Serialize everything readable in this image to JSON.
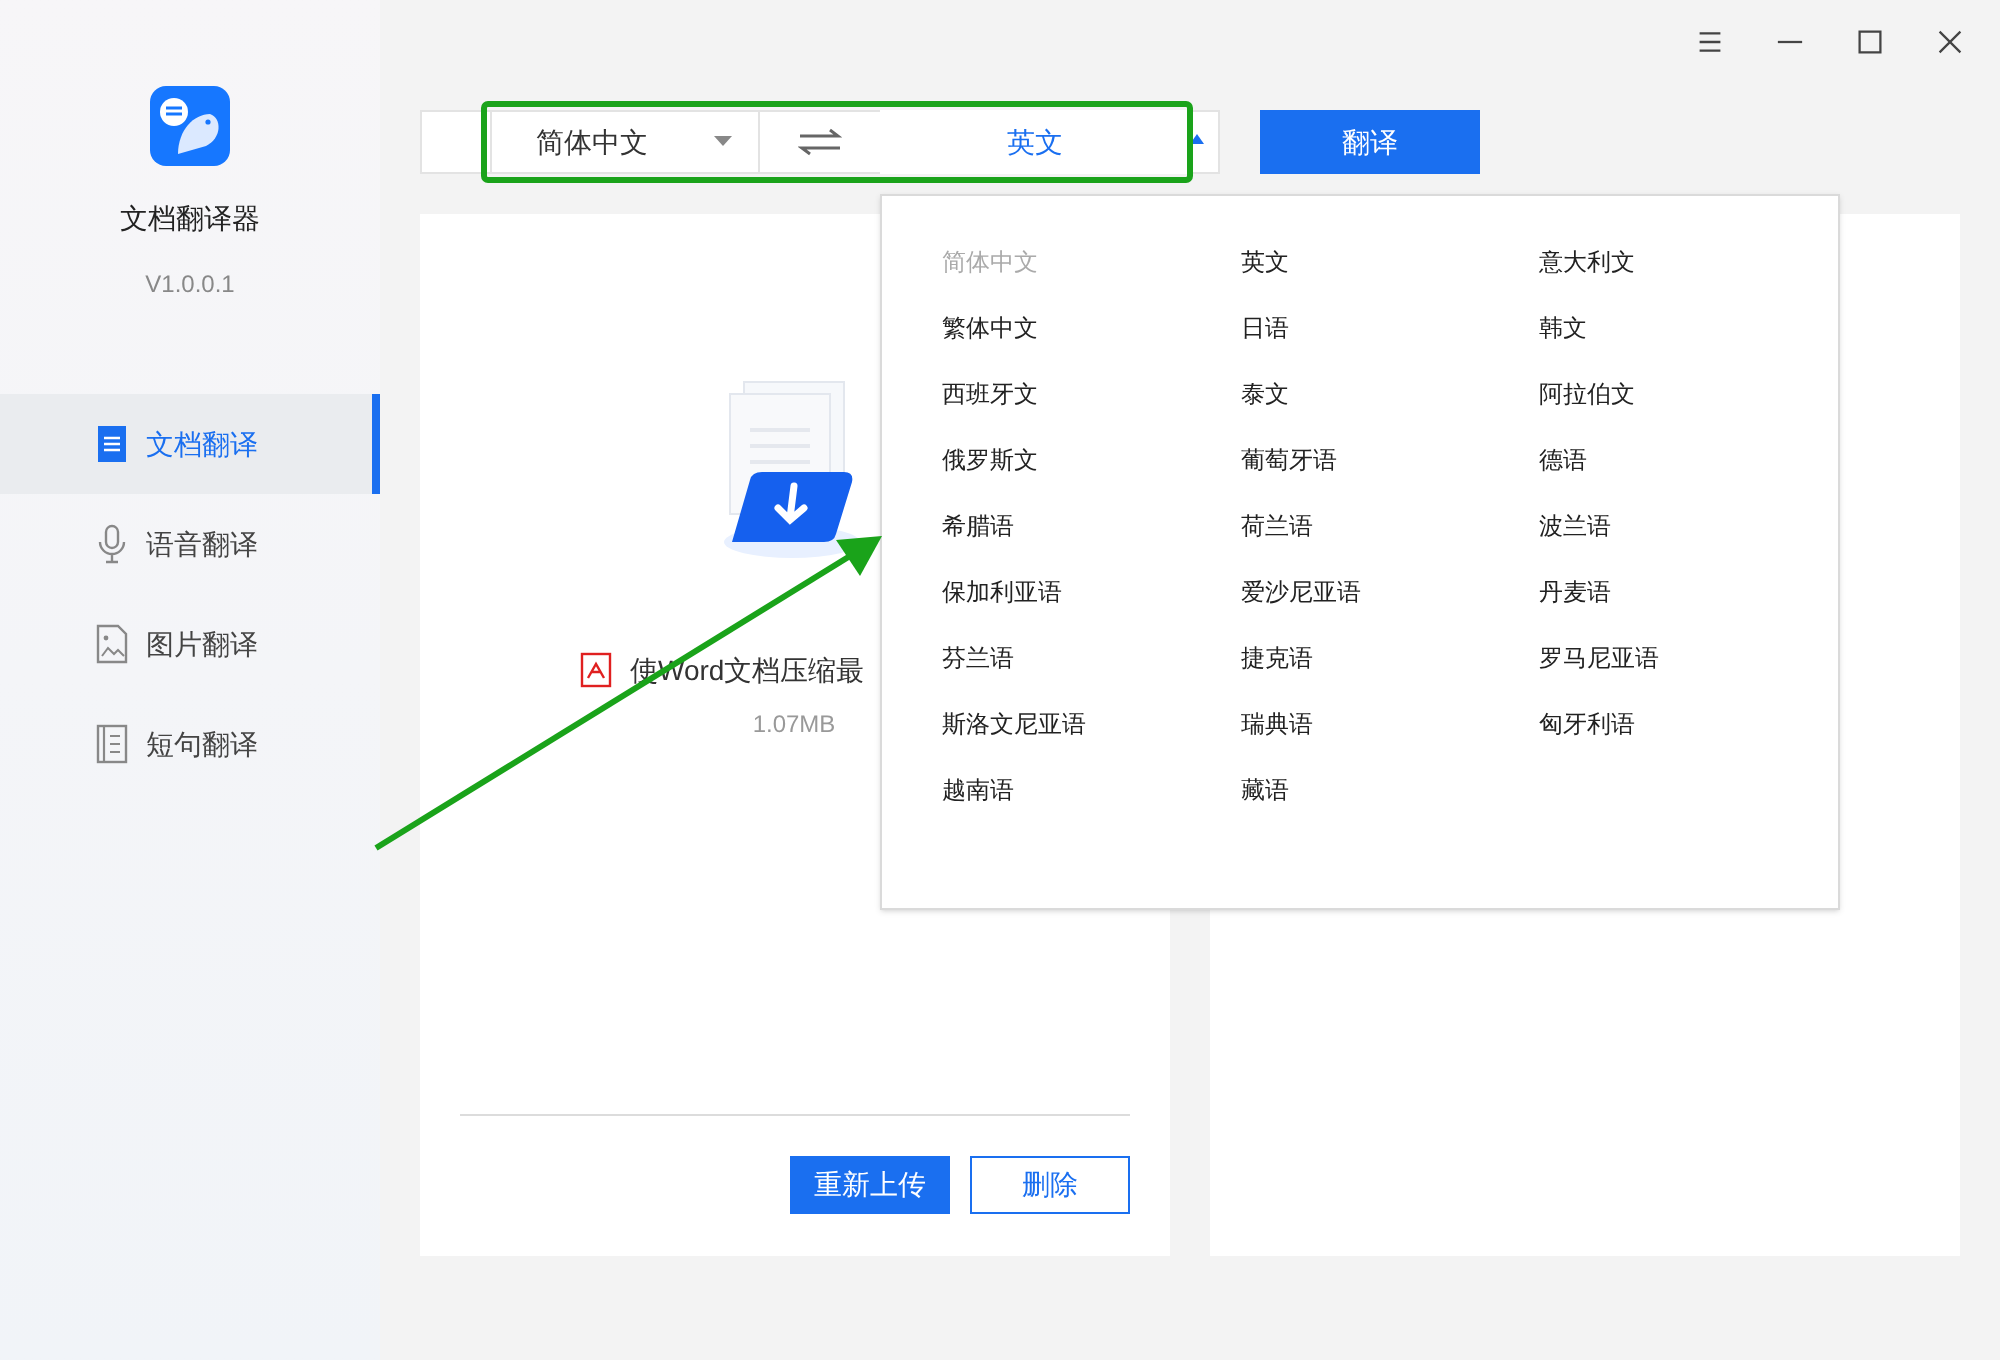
{
  "app": {
    "name": "文档翻译器",
    "version": "V1.0.0.1"
  },
  "window_controls": [
    {
      "kind": "menu"
    },
    {
      "kind": "minimize"
    },
    {
      "kind": "maximize"
    },
    {
      "kind": "close"
    }
  ],
  "sidebar": {
    "items": [
      {
        "label": "文档翻译",
        "kind": "document",
        "selected": true
      },
      {
        "label": "语音翻译",
        "kind": "voice",
        "selected": false
      },
      {
        "label": "图片翻译",
        "kind": "image",
        "selected": false
      },
      {
        "label": "短句翻译",
        "kind": "sentence",
        "selected": false
      }
    ]
  },
  "toolbar": {
    "source_language": "简体中文",
    "target_language": "英文",
    "target_open": true,
    "translate_button": "翻译"
  },
  "file_card": {
    "file_name": "使Word文档压缩最",
    "file_size": "1.07MB",
    "buttons": [
      {
        "label": "重新上传",
        "kind": "primary"
      },
      {
        "label": "删除",
        "kind": "outline"
      }
    ]
  },
  "language_menu": {
    "items": [
      {
        "label": "简体中文",
        "disabled": true
      },
      {
        "label": "英文",
        "disabled": false
      },
      {
        "label": "意大利文",
        "disabled": false
      },
      {
        "label": "繁体中文",
        "disabled": false
      },
      {
        "label": "日语",
        "disabled": false
      },
      {
        "label": "韩文",
        "disabled": false
      },
      {
        "label": "西班牙文",
        "disabled": false
      },
      {
        "label": "泰文",
        "disabled": false
      },
      {
        "label": "阿拉伯文",
        "disabled": false
      },
      {
        "label": "俄罗斯文",
        "disabled": false
      },
      {
        "label": "葡萄牙语",
        "disabled": false
      },
      {
        "label": "德语",
        "disabled": false
      },
      {
        "label": "希腊语",
        "disabled": false
      },
      {
        "label": "荷兰语",
        "disabled": false
      },
      {
        "label": "波兰语",
        "disabled": false
      },
      {
        "label": "保加利亚语",
        "disabled": false
      },
      {
        "label": "爱沙尼亚语",
        "disabled": false
      },
      {
        "label": "丹麦语",
        "disabled": false
      },
      {
        "label": "芬兰语",
        "disabled": false
      },
      {
        "label": "捷克语",
        "disabled": false
      },
      {
        "label": "罗马尼亚语",
        "disabled": false
      },
      {
        "label": "斯洛文尼亚语",
        "disabled": false
      },
      {
        "label": "瑞典语",
        "disabled": false
      },
      {
        "label": "匈牙利语",
        "disabled": false
      },
      {
        "label": "越南语",
        "disabled": false
      },
      {
        "label": "藏语",
        "disabled": false
      }
    ]
  }
}
